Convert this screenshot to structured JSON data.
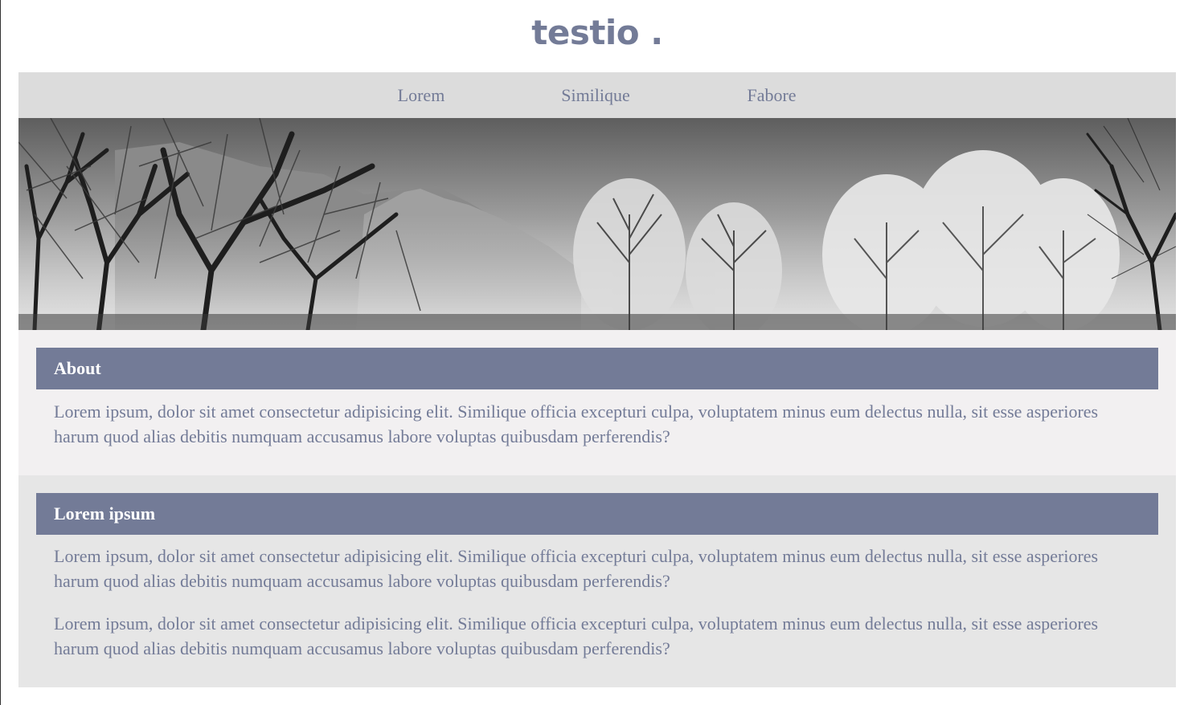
{
  "logo": {
    "text": "testio ."
  },
  "nav": {
    "items": [
      {
        "label": "Lorem"
      },
      {
        "label": "Similique"
      },
      {
        "label": "Fabore"
      }
    ]
  },
  "colors": {
    "accent": "#737b97",
    "nav_bg": "#dcdcdc",
    "section_one_bg": "#f2f0f1",
    "section_two_bg": "#e6e6e6"
  },
  "sections": [
    {
      "title": "About",
      "paragraphs": [
        "Lorem ipsum, dolor sit amet consectetur adipisicing elit. Similique officia excepturi culpa, voluptatem minus eum delectus nulla, sit esse asperiores harum quod alias debitis numquam accusamus labore voluptas quibusdam perferendis?"
      ]
    },
    {
      "title": "Lorem ipsum",
      "paragraphs": [
        "Lorem ipsum, dolor sit amet consectetur adipisicing elit. Similique officia excepturi culpa, voluptatem minus eum delectus nulla, sit esse asperiores harum quod alias debitis numquam accusamus labore voluptas quibusdam perferendis?",
        "Lorem ipsum, dolor sit amet consectetur adipisicing elit. Similique officia excepturi culpa, voluptatem minus eum delectus nulla, sit esse asperiores harum quod alias debitis numquam accusamus labore voluptas quibusdam perferendis?"
      ]
    }
  ]
}
